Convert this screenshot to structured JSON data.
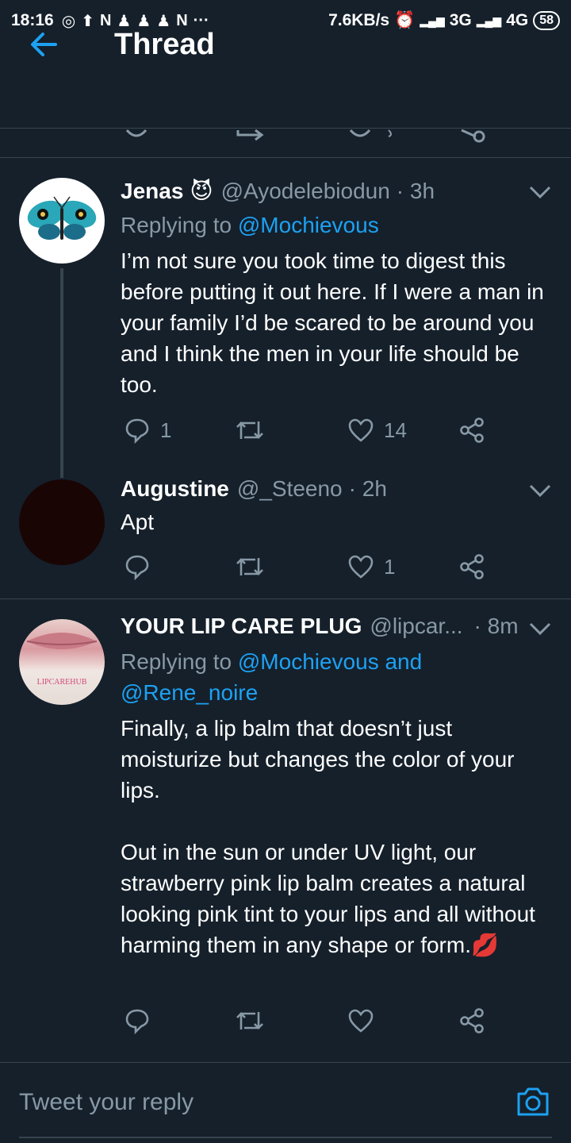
{
  "status_bar": {
    "time": "18:16",
    "net_speed": "7.6KB/s",
    "sim1": "3G",
    "sim2": "4G",
    "battery": "58"
  },
  "app_bar": {
    "title": "Thread"
  },
  "tweets": [
    {
      "name": "Jenas",
      "emoji": "😈",
      "handle": "@Ayodelebiodun",
      "time": "· 3h",
      "replying_prefix": "Replying to",
      "replying_to": "@Mochievous",
      "text": "I’m not sure you took time to digest this before putting it out here. If I were a man in your family I’d be scared to be around you and I think the men in your life should be too.",
      "replies": "1",
      "likes": "14"
    },
    {
      "name": "Augustine",
      "handle": "@_Steeno",
      "time": "· 2h",
      "text": "Apt",
      "likes": "1"
    },
    {
      "name": "YOUR LIP CARE PLUG",
      "handle": "@lipcar...",
      "time": "· 8m",
      "replying_prefix": "Replying to",
      "replying_to_line1": "@Mochievous and",
      "replying_to_line2": "@Rene_noire",
      "avatar_text": "LIPCAREHUB",
      "text": "Finally, a lip balm that doesn’t just moisturize but changes the color of your lips.\n\nOut in the sun or under UV light, our strawberry pink lip balm creates a natural looking pink tint to your lips and all without harming them in any shape or form.💋"
    }
  ],
  "compose": {
    "placeholder": "Tweet your reply"
  },
  "colors": {
    "background": "#15202b",
    "accent": "#1da1f2",
    "muted": "#8899a6",
    "divider": "#38444d"
  }
}
